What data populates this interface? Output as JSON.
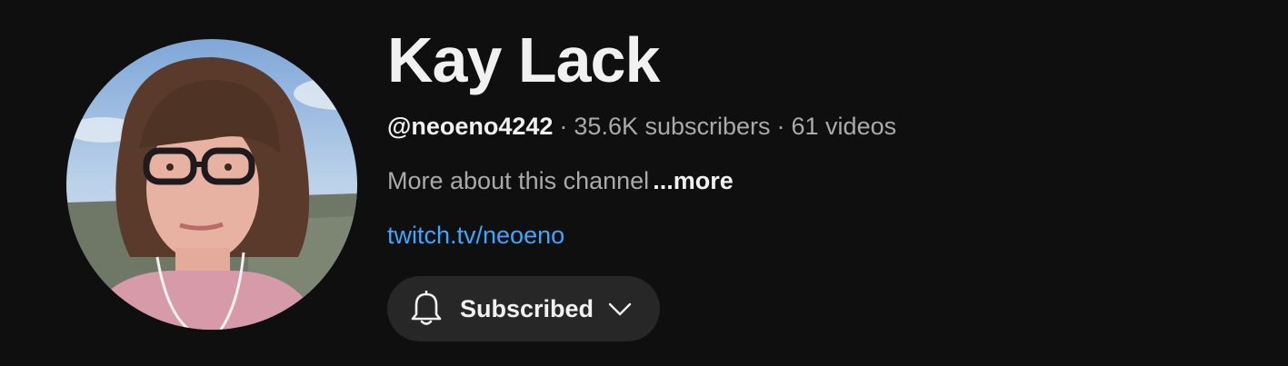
{
  "channel": {
    "name": "Kay Lack",
    "handle": "@neoeno4242",
    "separator": "·",
    "subscribers": "35.6K subscribers",
    "videos": "61 videos",
    "description": "More about this channel",
    "more_label": "...more",
    "link": "twitch.tv/neoeno"
  },
  "subscribe_button": {
    "label": "Subscribed",
    "bell_icon": "bell-icon",
    "chevron_icon": "chevron-down-icon"
  },
  "colors": {
    "background": "#0f0f0f",
    "text_primary": "#f1f1f1",
    "text_secondary": "#aaaaaa",
    "link": "#3ea6ff",
    "button_bg": "#272727"
  }
}
